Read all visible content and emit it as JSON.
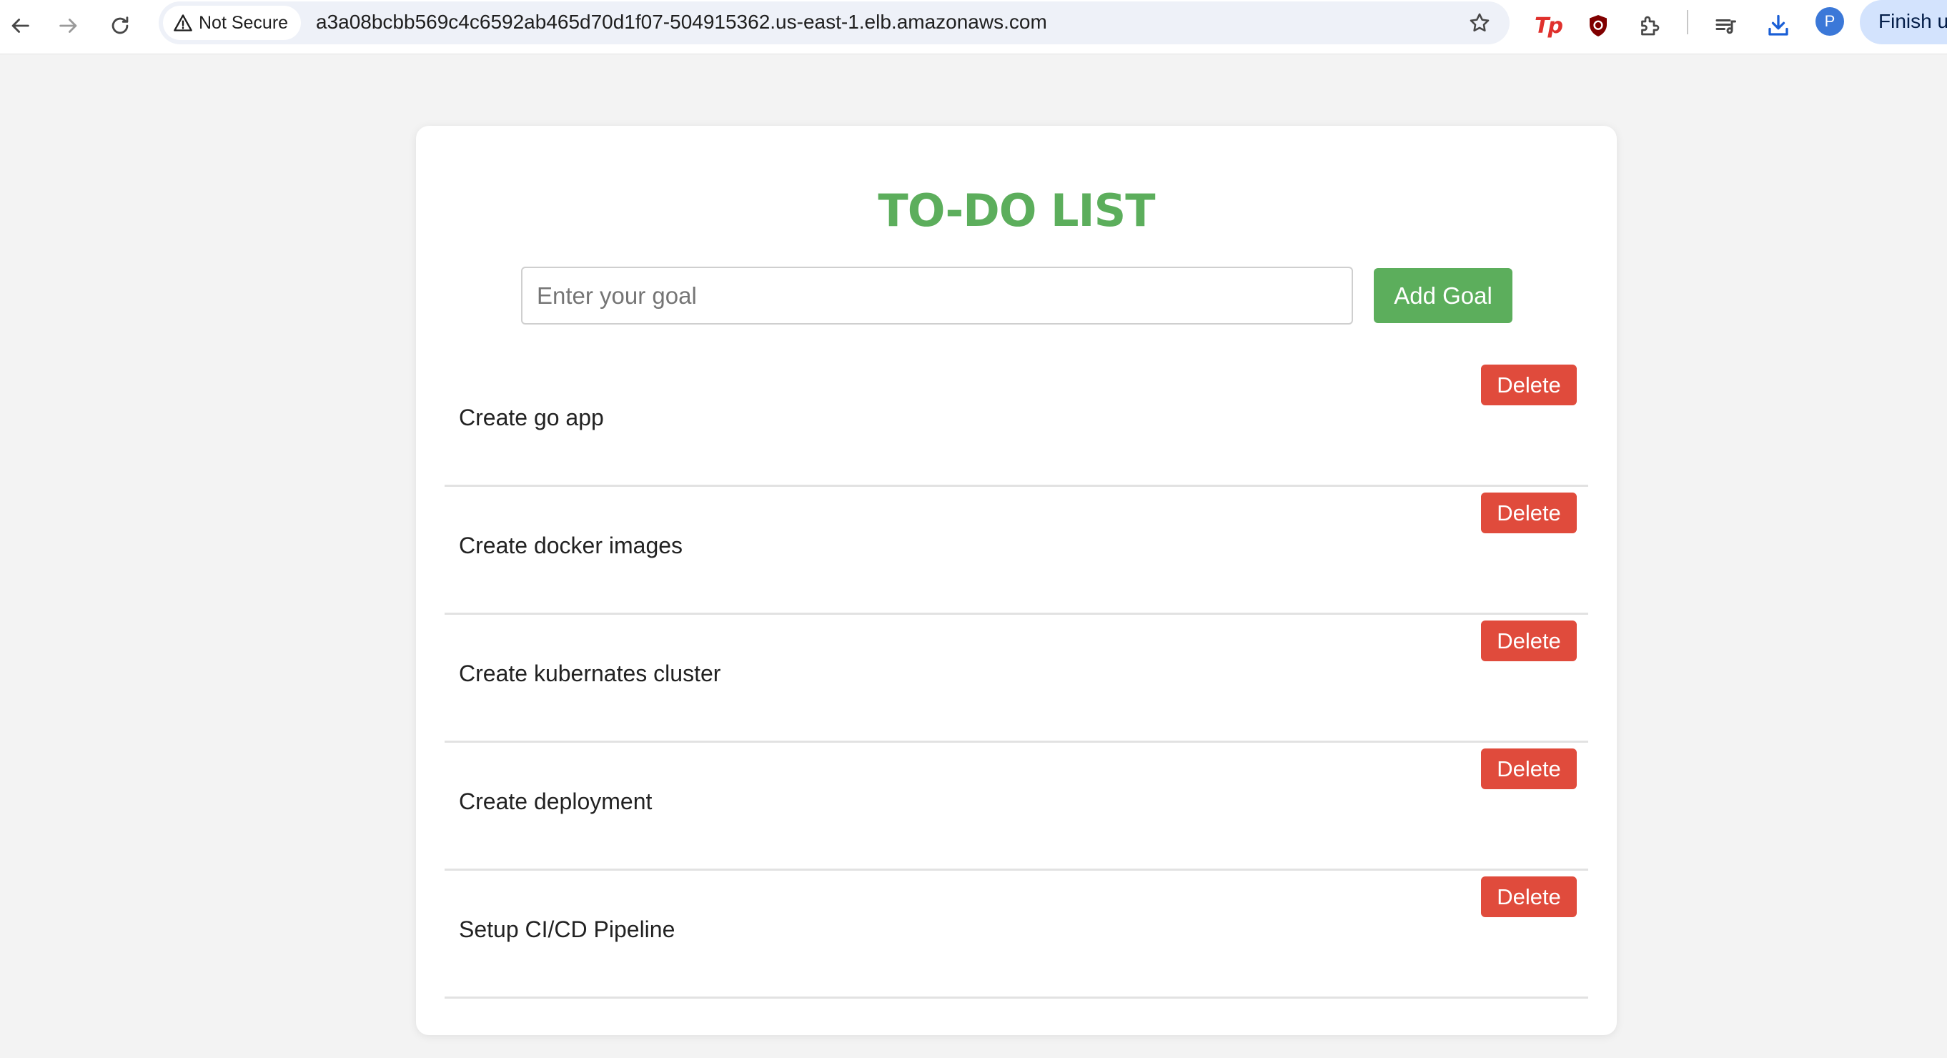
{
  "browser": {
    "security_label": "Not Secure",
    "url": "a3a08bcbb569c4c6592ab465d70d1f07-504915362.us-east-1.elb.amazonaws.com",
    "avatar_letter": "P",
    "finish_label": "Finish u",
    "toolbar_icons": [
      "back-arrow-icon",
      "forward-arrow-icon",
      "reload-icon",
      "warning-triangle-icon",
      "bookmark-star-icon",
      "tp-extension-icon",
      "ublock-shield-icon",
      "extensions-puzzle-icon",
      "reading-list-icon",
      "download-icon"
    ]
  },
  "app": {
    "title": "TO-DO LIST",
    "input_placeholder": "Enter your goal",
    "input_value": "",
    "add_button_label": "Add Goal",
    "items": [
      {
        "text": "Create go app",
        "delete_label": "Delete"
      },
      {
        "text": "Create docker images",
        "delete_label": "Delete"
      },
      {
        "text": "Create kubernates cluster",
        "delete_label": "Delete"
      },
      {
        "text": "Create deployment",
        "delete_label": "Delete"
      },
      {
        "text": "Setup CI/CD Pipeline",
        "delete_label": "Delete"
      }
    ]
  },
  "colors": {
    "accent_green": "#5cae5c",
    "delete_red": "#e04b3c",
    "page_background": "#f3f3f3"
  }
}
